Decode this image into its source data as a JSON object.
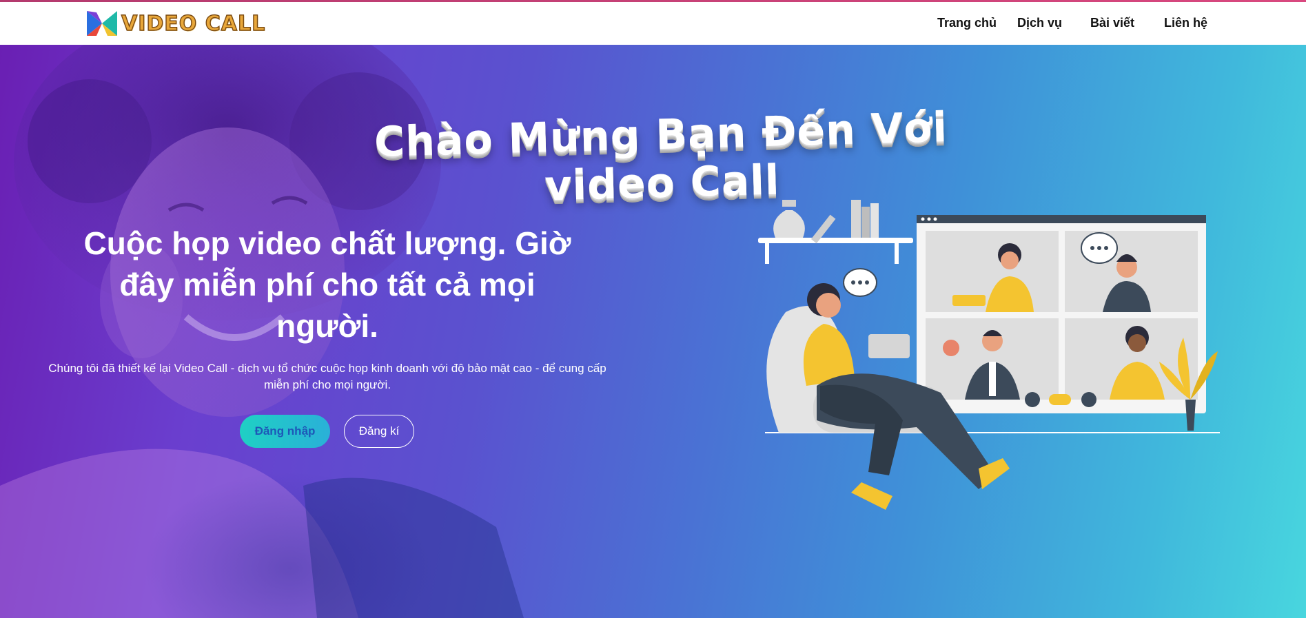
{
  "brand": {
    "name": "VIDEO CALL"
  },
  "nav": {
    "items": [
      "Trang chủ",
      "Dịch vụ",
      "Bài viết",
      "Liên hệ"
    ]
  },
  "hero": {
    "welcome": "Chào Mừng Bạn Đến Với video Call",
    "headline": "Cuộc họp video chất lượng. Giờ đây miễn phí cho tất cả mọi người.",
    "subtext": "Chúng tôi đã thiết kế lại Video Call - dịch vụ tổ chức cuộc họp kinh doanh với độ bảo mật cao - để cung cấp miễn phí cho mọi người.",
    "login_label": "Đăng nhập",
    "register_label": "Đăng kí"
  },
  "colors": {
    "accent_top": "#d9487f",
    "logo_gold": "#e8a73a",
    "button_teal": "#1fd0c4",
    "button_text": "#1d58b8"
  }
}
